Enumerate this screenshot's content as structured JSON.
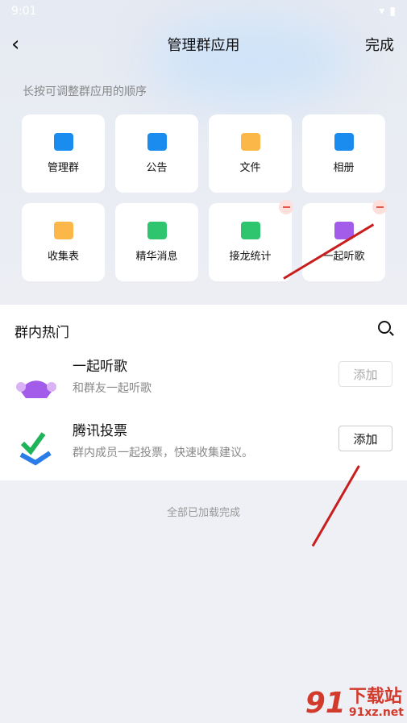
{
  "status": {
    "time": "9:01"
  },
  "nav": {
    "title": "管理群应用",
    "done": "完成"
  },
  "hint": "长按可调整群应用的顺序",
  "apps": [
    {
      "label": "管理群",
      "icon": "manage-group-icon",
      "color": "#1a8cf0",
      "removable": false
    },
    {
      "label": "公告",
      "icon": "announcement-icon",
      "color": "#1a8cf0",
      "removable": false
    },
    {
      "label": "文件",
      "icon": "folder-icon",
      "color": "#fbb848",
      "removable": false
    },
    {
      "label": "相册",
      "icon": "album-icon",
      "color": "#1a8cf0",
      "removable": false
    },
    {
      "label": "收集表",
      "icon": "clipboard-icon",
      "color": "#fbb848",
      "removable": false
    },
    {
      "label": "精华消息",
      "icon": "essence-message-icon",
      "color": "#2fc46e",
      "removable": false
    },
    {
      "label": "接龙统计",
      "icon": "relay-stats-icon",
      "color": "#2fc46e",
      "removable": true
    },
    {
      "label": "一起听歌",
      "icon": "listen-together-icon",
      "color": "#a35bea",
      "removable": true
    }
  ],
  "hot": {
    "title": "群内热门",
    "items": [
      {
        "name": "一起听歌",
        "desc": "和群友一起听歌",
        "button": "添加",
        "enabled": false
      },
      {
        "name": "腾讯投票",
        "desc": "群内成员一起投票，快速收集建议。",
        "button": "添加",
        "enabled": true
      }
    ]
  },
  "footer": "全部已加载完成",
  "watermark": {
    "number": "91",
    "text": "下载站",
    "url": "91xz.net"
  }
}
